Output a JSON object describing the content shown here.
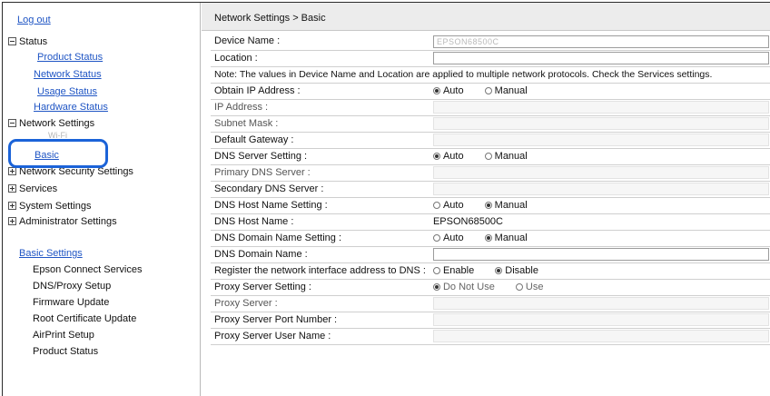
{
  "sidebar": {
    "logout": "Log out",
    "status": {
      "label": "Status",
      "items": [
        "Product Status",
        "Network Status",
        "Usage Status",
        "Hardware Status"
      ]
    },
    "network_settings": {
      "label": "Network Settings",
      "faded_item": "Wi-Fi",
      "selected": "Basic",
      "partial_item": "Network Security Settings"
    },
    "services": "Services",
    "system_settings": "System Settings",
    "administrator_settings": "Administrator Settings",
    "basic_settings": {
      "label": "Basic Settings",
      "items": [
        "Epson Connect Services",
        "DNS/Proxy Setup",
        "Firmware Update",
        "Root Certificate Update",
        "AirPrint Setup",
        "Product Status"
      ]
    }
  },
  "breadcrumb": "Network Settings > Basic",
  "form": {
    "device_name": {
      "label": "Device Name :",
      "value": "EPSON68500C"
    },
    "location": {
      "label": "Location :",
      "value": ""
    },
    "note": "Note: The values in Device Name and Location are applied to multiple network protocols. Check the Services settings.",
    "obtain_ip": {
      "label": "Obtain IP Address :",
      "options": [
        "Auto",
        "Manual"
      ],
      "selected": "Auto"
    },
    "ip_address": {
      "label": "IP Address :"
    },
    "subnet_mask": {
      "label": "Subnet Mask :"
    },
    "default_gateway": {
      "label": "Default Gateway :"
    },
    "dns_server_setting": {
      "label": "DNS Server Setting :",
      "options": [
        "Auto",
        "Manual"
      ],
      "selected": "Auto"
    },
    "primary_dns": {
      "label": "Primary DNS Server :"
    },
    "secondary_dns": {
      "label": "Secondary DNS Server :"
    },
    "dns_host_name_setting": {
      "label": "DNS Host Name Setting :",
      "options": [
        "Auto",
        "Manual"
      ],
      "selected": "Manual"
    },
    "dns_host_name": {
      "label": "DNS Host Name :",
      "value": "EPSON68500C"
    },
    "dns_domain_name_setting": {
      "label": "DNS Domain Name Setting :",
      "options": [
        "Auto",
        "Manual"
      ],
      "selected": "Manual"
    },
    "dns_domain_name": {
      "label": "DNS Domain Name :"
    },
    "register_dns": {
      "label": "Register the network interface address to DNS :",
      "options": [
        "Enable",
        "Disable"
      ],
      "selected": "Disable"
    },
    "proxy_server_setting": {
      "label": "Proxy Server Setting :",
      "options": [
        "Do Not Use",
        "Use"
      ],
      "selected": "Do Not Use"
    },
    "proxy_server": {
      "label": "Proxy Server :"
    },
    "proxy_port": {
      "label": "Proxy Server Port Number :"
    },
    "proxy_user": {
      "label": "Proxy Server User Name :"
    }
  },
  "colors": {
    "link": "#1f55c4",
    "highlight": "#1b63d8",
    "header_bg": "#ececec"
  }
}
